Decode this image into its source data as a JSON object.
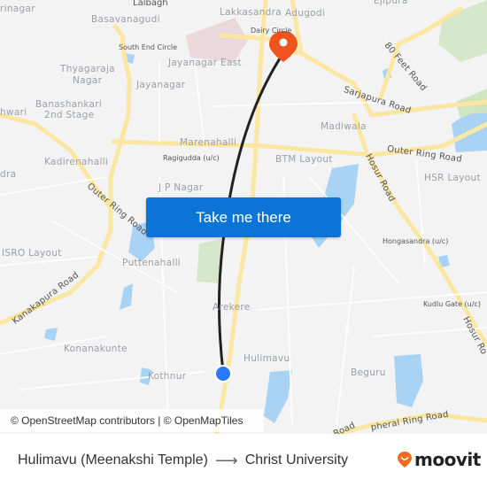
{
  "map": {
    "labels": {
      "rinagar": "rinagar",
      "lalbagh": "Lalbagh",
      "lakkasandra": "Lakkasandra",
      "adugodi": "Adugodi",
      "ejipura": "Ejipura",
      "basavanagudi": "Basavanagudi",
      "dairy_circle": "Dairy Circle",
      "south_end_circle": "South End Circle",
      "jayanagar_east": "Jayanagar East",
      "thyagaraja_1": "Thyagaraja",
      "thyagaraja_2": "Nagar",
      "jayanagar": "Jayanagar",
      "banashankari_1": "Banashankari",
      "banashankari_2": "2nd Stage",
      "hwari": "hwari",
      "madiwala": "Madiwala",
      "marenahalli": "Marenahalli",
      "ragigudda": "Ragigudda (u/c)",
      "btm_layout": "BTM Layout",
      "kadirenahalli": "Kadirenahalli",
      "dra": "dra",
      "hsr_layout": "HSR Layout",
      "jp_nagar": "J P Nagar",
      "hongasandra": "Hongasandra (u/c)",
      "isro_layout": "ISRO Layout",
      "puttenahalli": "Puttenahalli",
      "arekere": "Arekere",
      "kudlu_gate": "Kudlu Gate (u/c)",
      "konanakunte": "Konanakunte",
      "hulimavu": "Hulimavu",
      "kothnur": "Kothnur",
      "beguru": "Beguru"
    },
    "roads": {
      "eighty_feet": "80 Feet Road",
      "sarjapura": "Sarjapura Road",
      "outer_ring_east": "Outer Ring Road",
      "hosur_1": "Hosur Road",
      "hosur_2": "Hosur Ro",
      "outer_ring_west": "Outer Ring Road",
      "kanakapura": "Kanakapura Road",
      "peripheral": "pheral Ring Road",
      "road_s": "Road"
    },
    "colors": {
      "background": "#f3f3f4",
      "road_major": "#fbe7a1",
      "water": "#a9d3f5",
      "park": "#cfe5c0",
      "route_line": "#222222",
      "destination_pin": "#f0531c",
      "origin_dot": "#2979ff"
    }
  },
  "cta": {
    "label": "Take me there",
    "color": "#0b74d6"
  },
  "attribution": "© OpenStreetMap contributors | © OpenMapTiles",
  "footer": {
    "origin": "Hulimavu (Meenakshi Temple)",
    "arrow": "⟶",
    "destination": "Christ University",
    "brand": "moovit",
    "brand_color": "#f26b21"
  }
}
